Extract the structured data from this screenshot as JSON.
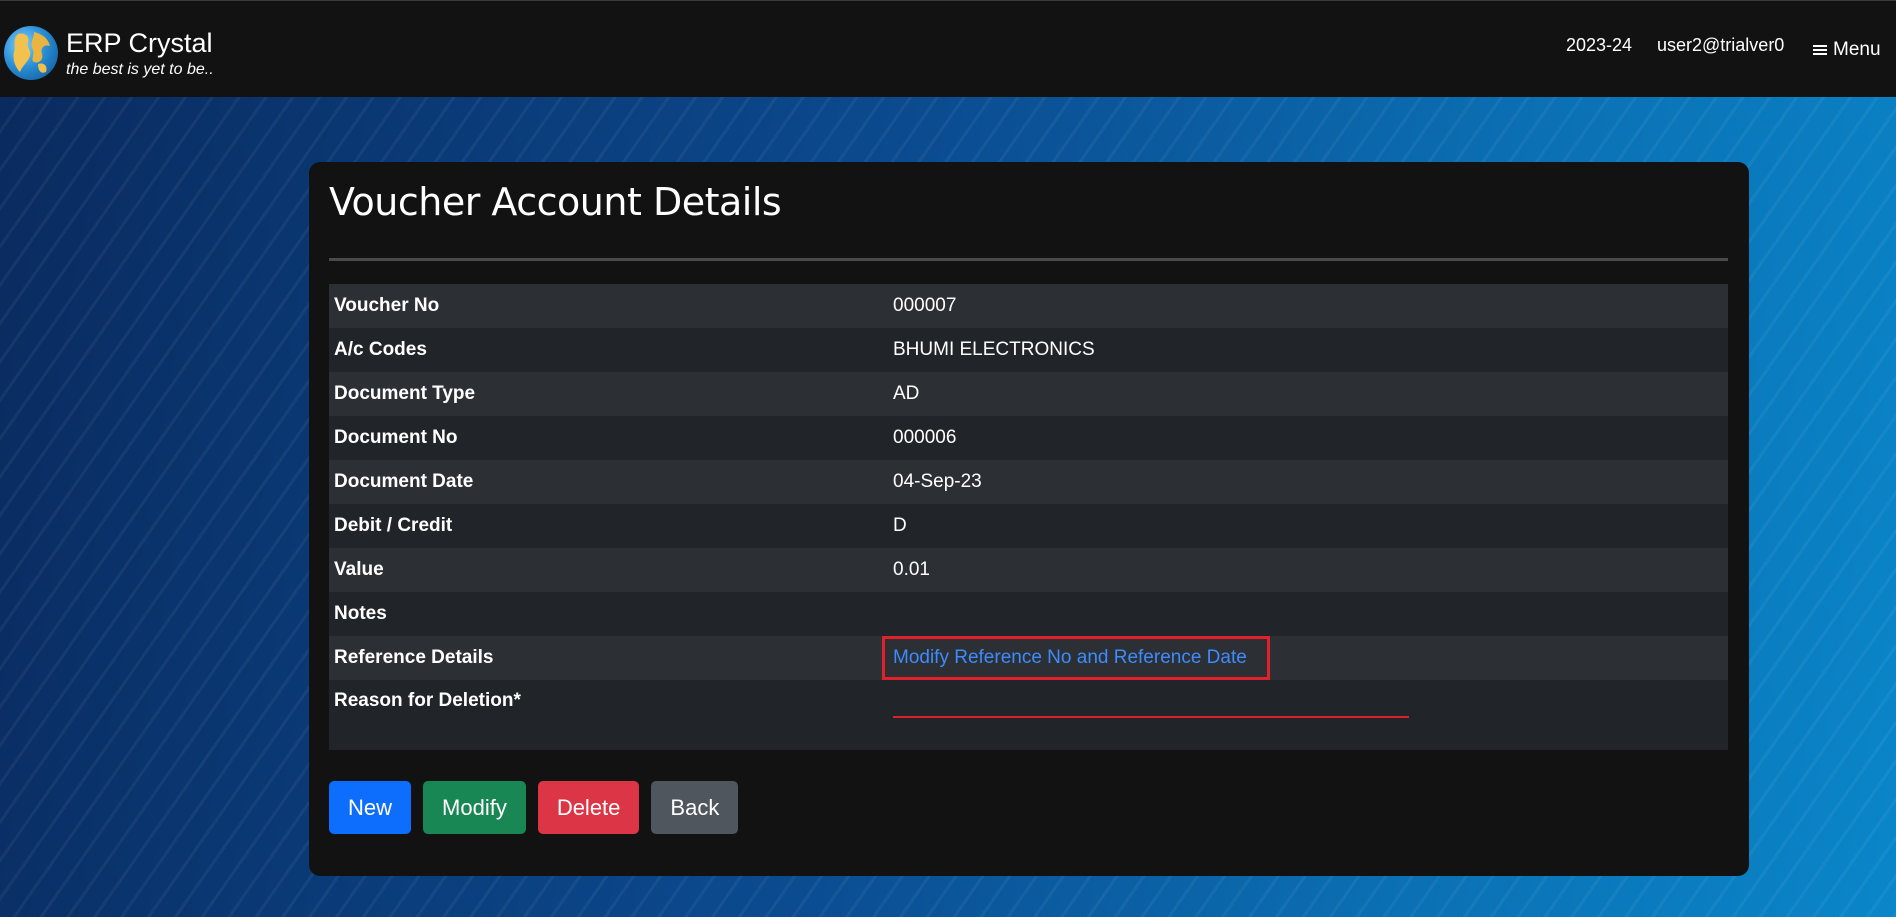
{
  "navbar": {
    "brand_name": "ERP Crystal",
    "brand_tagline": "the best is yet to be..",
    "year": "2023-24",
    "user": "user2@trialver0",
    "menu_label": "Menu"
  },
  "card": {
    "title": "Voucher Account Details",
    "rows": [
      {
        "label": "Voucher No",
        "value": "000007"
      },
      {
        "label": "A/c Codes",
        "value": "BHUMI ELECTRONICS"
      },
      {
        "label": "Document Type",
        "value": "AD"
      },
      {
        "label": "Document No",
        "value": "000006"
      },
      {
        "label": "Document Date",
        "value": "04-Sep-23"
      },
      {
        "label": "Debit / Credit",
        "value": "D"
      },
      {
        "label": "Value",
        "value": "0.01"
      },
      {
        "label": "Notes",
        "value": ""
      },
      {
        "label": "Reference Details",
        "link_text": "Modify Reference No and Reference Date"
      },
      {
        "label": "Reason for Deletion*",
        "input_value": ""
      }
    ]
  },
  "buttons": {
    "new": "New",
    "modify": "Modify",
    "delete": "Delete",
    "back": "Back"
  },
  "colors": {
    "navbar_bg": "#121212",
    "card_bg": "#121212",
    "link": "#3d8bfd",
    "highlight_box": "#e0202a",
    "new_button": "#0d6efd",
    "modify_button": "#198754",
    "delete_button": "#dc3545",
    "back_button": "#4f565d"
  }
}
